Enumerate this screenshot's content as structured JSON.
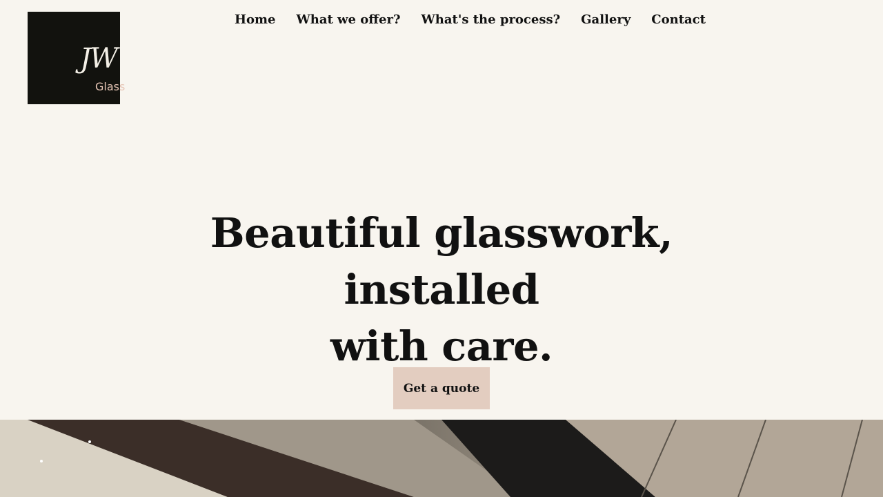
{
  "logo": {
    "mark": "JW",
    "word": "Glass"
  },
  "nav": {
    "items": [
      {
        "label": "Home"
      },
      {
        "label": "What we offer?"
      },
      {
        "label": "What's the process?"
      },
      {
        "label": "Gallery"
      },
      {
        "label": "Contact"
      }
    ]
  },
  "hero": {
    "title_line1": "Beautiful glasswork, installed",
    "title_line2": "with care."
  },
  "cta": {
    "label": "Get a quote"
  },
  "colors": {
    "background": "#f8f5ef",
    "logo_bg": "#12120e",
    "cta_bg": "#e3cdc0"
  },
  "icons": {
    "photo": "kitchen-photo"
  }
}
